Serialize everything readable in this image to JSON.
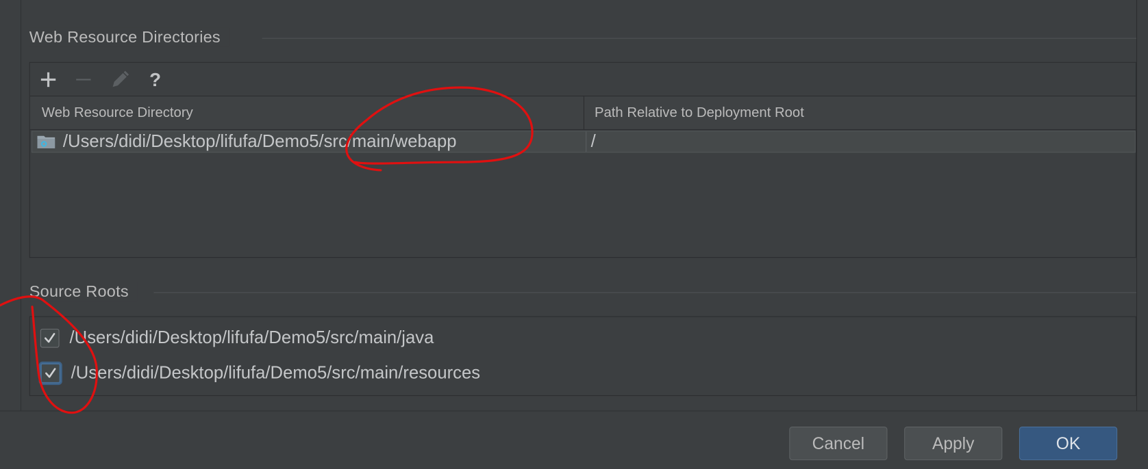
{
  "web_resources": {
    "title": "Web Resource Directories",
    "toolbar": {
      "add_icon": "plus-icon",
      "remove_icon": "minus-icon",
      "edit_icon": "pencil-icon",
      "help_label": "?"
    },
    "columns": [
      "Web Resource Directory",
      "Path Relative to Deployment Root"
    ],
    "rows": [
      {
        "directory": "/Users/didi/Desktop/lifufa/Demo5/src/main/webapp",
        "relative_path": "/"
      }
    ]
  },
  "source_roots": {
    "title": "Source Roots",
    "items": [
      {
        "label": "/Users/didi/Desktop/lifufa/Demo5/src/main/java",
        "checked": true
      },
      {
        "label": "/Users/didi/Desktop/lifufa/Demo5/src/main/resources",
        "checked": true
      }
    ]
  },
  "buttons": {
    "cancel": "Cancel",
    "apply": "Apply",
    "ok": "OK"
  },
  "colors": {
    "background": "#3c3f41",
    "primary_button": "#365880",
    "annotation": "#e01010"
  }
}
